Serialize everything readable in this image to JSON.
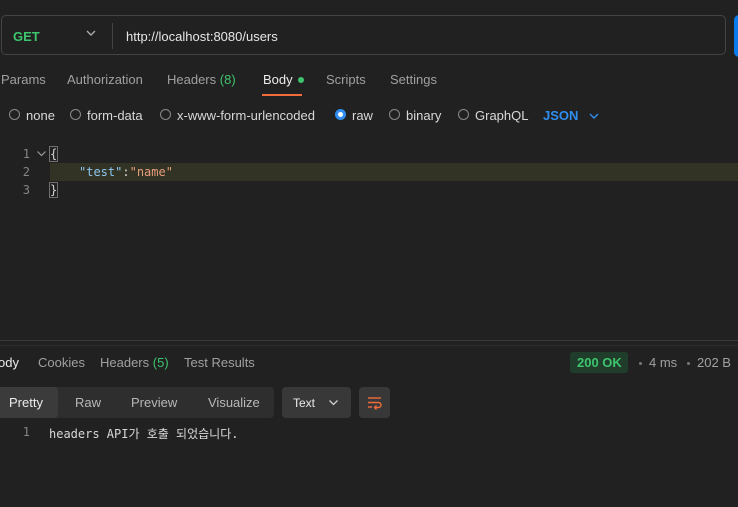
{
  "request": {
    "method": "GET",
    "url": "http://localhost:8080/users"
  },
  "request_tabs": [
    {
      "label": "Params"
    },
    {
      "label": "Authorization"
    },
    {
      "label": "Headers",
      "count": "(8)"
    },
    {
      "label": "Body",
      "active": true,
      "has_dot": true
    },
    {
      "label": "Scripts"
    },
    {
      "label": "Settings"
    }
  ],
  "body_options": {
    "items": [
      "none",
      "form-data",
      "x-www-form-urlencoded",
      "raw",
      "binary",
      "GraphQL"
    ],
    "selected": "raw",
    "format": "JSON"
  },
  "editor": {
    "line_numbers": [
      "1",
      "2",
      "3"
    ],
    "open_brace": "{",
    "key": "\"test\"",
    "colon": ":",
    "value": "\"name\"",
    "close_brace": "}"
  },
  "response_tabs": [
    {
      "label": "Body",
      "visible_label": "ody",
      "active": true
    },
    {
      "label": "Cookies"
    },
    {
      "label": "Headers",
      "count": "(5)"
    },
    {
      "label": "Test Results"
    }
  ],
  "response_meta": {
    "status": "200 OK",
    "time": "4 ms",
    "size": "202 B"
  },
  "response_view": {
    "modes": [
      "Pretty",
      "Raw",
      "Preview",
      "Visualize"
    ],
    "active_mode": "Pretty",
    "format": "Text"
  },
  "response_body": {
    "line_number": "1",
    "text": "headers API가 호출 되었습니다."
  },
  "colors": {
    "accent_orange": "#f26b3a",
    "accent_green": "#3ec46d",
    "accent_blue": "#2f8ef0",
    "background": "#212121"
  }
}
